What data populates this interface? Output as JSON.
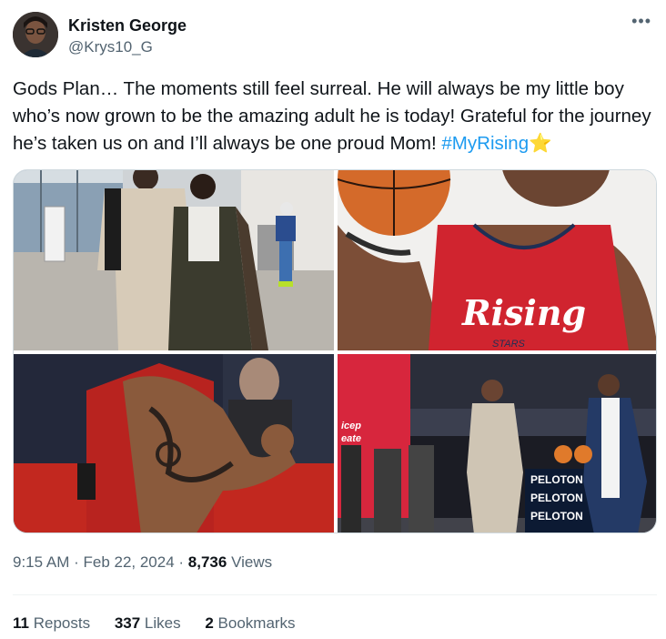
{
  "author": {
    "name": "Kristen George",
    "handle": "@Krys10_G"
  },
  "more_menu_label": "•••",
  "tweet": {
    "text": "Gods Plan… The moments still feel surreal. He will always be my little boy who’s now grown to be the amazing adult he is today! Grateful for the journey he’s taken us on and I’ll always be one proud Mom! ",
    "hashtag": "#MyRising",
    "emoji": "⭐"
  },
  "media": {
    "photo2_jersey_text": "Rising",
    "photo2_jersey_sub": "STARS",
    "photo4_sign_lines": [
      "PELOTON",
      "PELOTON",
      "PELOTON"
    ],
    "photo4_wall_text": "icep\neate"
  },
  "meta": {
    "time": "9:15 AM",
    "sep1": " · ",
    "date": "Feb 22, 2024",
    "sep2": " · ",
    "views_count": "8,736",
    "views_label": " Views"
  },
  "stats": {
    "reposts_count": "11",
    "reposts_label": " Reposts",
    "likes_count": "337",
    "likes_label": " Likes",
    "bookmarks_count": "2",
    "bookmarks_label": " Bookmarks"
  },
  "colors": {
    "hashtag": "#1d9bf0",
    "secondary_text": "#536471",
    "primary_text": "#0f1419",
    "jersey_red": "#d0242f"
  }
}
